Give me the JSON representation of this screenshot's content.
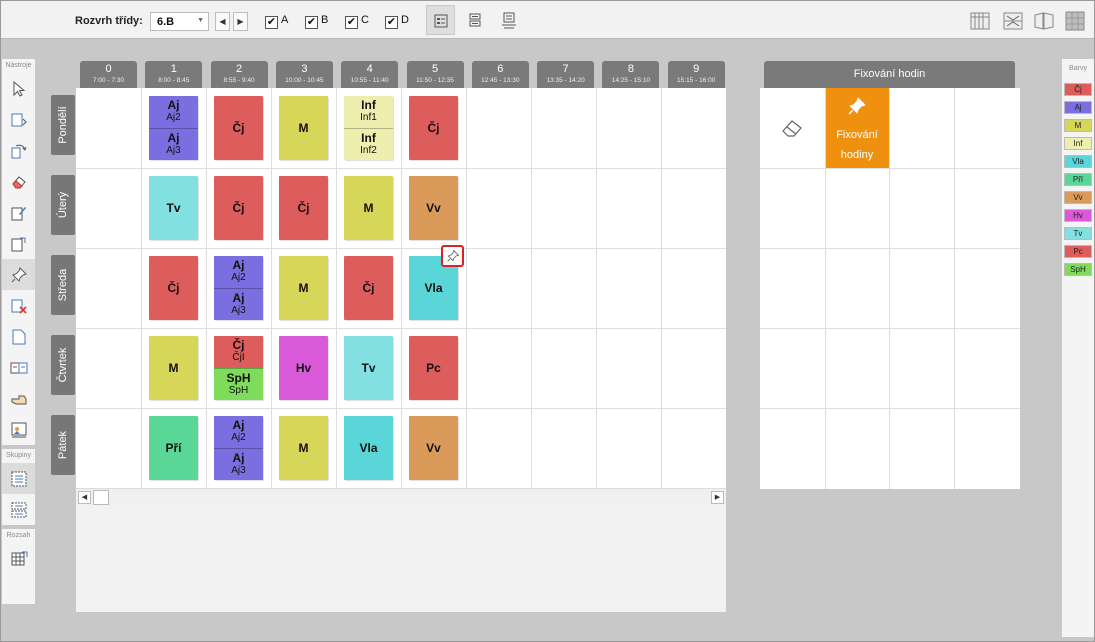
{
  "toolbar": {
    "class_label": "Rozvrh třídy:",
    "class_value": "6.B",
    "prev_arrow": "◀",
    "next_arrow": "▶",
    "groups": [
      {
        "label": "A",
        "checked": true
      },
      {
        "label": "B",
        "checked": true
      },
      {
        "label": "C",
        "checked": true
      },
      {
        "label": "D",
        "checked": true
      }
    ],
    "check_mark": "✔"
  },
  "left_panel": {
    "tools_title": "Nástroje",
    "groups_title": "Skupiny",
    "range_title": "Rozsah"
  },
  "periods": [
    {
      "num": "0",
      "time": "7:00 - 7:30"
    },
    {
      "num": "1",
      "time": "8:00 - 8:45"
    },
    {
      "num": "2",
      "time": "8:55 - 9:40"
    },
    {
      "num": "3",
      "time": "10:00 - 10:45"
    },
    {
      "num": "4",
      "time": "10:55 - 11:40"
    },
    {
      "num": "5",
      "time": "11:50 - 12:35"
    },
    {
      "num": "6",
      "time": "12:45 - 13:30"
    },
    {
      "num": "7",
      "time": "13:35 - 14:20"
    },
    {
      "num": "8",
      "time": "14:25 - 15:10"
    },
    {
      "num": "9",
      "time": "15:15 - 16:00"
    }
  ],
  "days": [
    "Pondělí",
    "Úterý",
    "Středa",
    "Čtvrtek",
    "Pátek"
  ],
  "lessons": [
    {
      "day": 0,
      "period": 1,
      "parts": [
        {
          "s": "Aj",
          "g": "Aj2",
          "color": "#7a6ee0"
        },
        {
          "s": "Aj",
          "g": "Aj3",
          "color": "#7a6ee0"
        }
      ]
    },
    {
      "day": 0,
      "period": 2,
      "parts": [
        {
          "s": "Čj",
          "color": "#dd5c5c"
        }
      ]
    },
    {
      "day": 0,
      "period": 3,
      "parts": [
        {
          "s": "M",
          "color": "#d6d758"
        }
      ]
    },
    {
      "day": 0,
      "period": 4,
      "parts": [
        {
          "s": "Inf",
          "g": "Inf1",
          "color": "#eeeeae"
        },
        {
          "s": "Inf",
          "g": "Inf2",
          "color": "#eeeeae"
        }
      ]
    },
    {
      "day": 0,
      "period": 5,
      "parts": [
        {
          "s": "Čj",
          "color": "#dd5c5c"
        }
      ]
    },
    {
      "day": 1,
      "period": 1,
      "parts": [
        {
          "s": "Tv",
          "color": "#82e0e0"
        }
      ]
    },
    {
      "day": 1,
      "period": 2,
      "parts": [
        {
          "s": "Čj",
          "color": "#dd5c5c"
        }
      ]
    },
    {
      "day": 1,
      "period": 3,
      "parts": [
        {
          "s": "Čj",
          "color": "#dd5c5c"
        }
      ]
    },
    {
      "day": 1,
      "period": 4,
      "parts": [
        {
          "s": "M",
          "color": "#d6d758"
        }
      ]
    },
    {
      "day": 1,
      "period": 5,
      "parts": [
        {
          "s": "Vv",
          "color": "#d99a5a"
        }
      ]
    },
    {
      "day": 2,
      "period": 1,
      "parts": [
        {
          "s": "Čj",
          "color": "#dd5c5c"
        }
      ]
    },
    {
      "day": 2,
      "period": 2,
      "parts": [
        {
          "s": "Aj",
          "g": "Aj2",
          "color": "#7a6ee0"
        },
        {
          "s": "Aj",
          "g": "Aj3",
          "color": "#7a6ee0"
        }
      ]
    },
    {
      "day": 2,
      "period": 3,
      "parts": [
        {
          "s": "M",
          "color": "#d6d758"
        }
      ]
    },
    {
      "day": 2,
      "period": 4,
      "parts": [
        {
          "s": "Čj",
          "color": "#dd5c5c"
        }
      ]
    },
    {
      "day": 2,
      "period": 5,
      "parts": [
        {
          "s": "Vla",
          "color": "#5ad6d8"
        }
      ]
    },
    {
      "day": 3,
      "period": 1,
      "parts": [
        {
          "s": "M",
          "color": "#d6d758"
        }
      ]
    },
    {
      "day": 3,
      "period": 2,
      "parts": [
        {
          "s": "Čj",
          "g": "ČjI",
          "color": "#dd5c5c"
        },
        {
          "s": "SpH",
          "g": "SpH",
          "color": "#7edc5a"
        }
      ]
    },
    {
      "day": 3,
      "period": 3,
      "parts": [
        {
          "s": "Hv",
          "color": "#d85ad8"
        }
      ]
    },
    {
      "day": 3,
      "period": 4,
      "parts": [
        {
          "s": "Tv",
          "color": "#82e0e0"
        }
      ]
    },
    {
      "day": 3,
      "period": 5,
      "parts": [
        {
          "s": "Pc",
          "color": "#dd5c5c"
        }
      ]
    },
    {
      "day": 4,
      "period": 1,
      "parts": [
        {
          "s": "Pří",
          "color": "#5ad696"
        }
      ]
    },
    {
      "day": 4,
      "period": 2,
      "parts": [
        {
          "s": "Aj",
          "g": "Aj2",
          "color": "#7a6ee0"
        },
        {
          "s": "Aj",
          "g": "Aj3",
          "color": "#7a6ee0"
        }
      ]
    },
    {
      "day": 4,
      "period": 3,
      "parts": [
        {
          "s": "M",
          "color": "#d6d758"
        }
      ]
    },
    {
      "day": 4,
      "period": 4,
      "parts": [
        {
          "s": "Vla",
          "color": "#5ad6d8"
        }
      ]
    },
    {
      "day": 4,
      "period": 5,
      "parts": [
        {
          "s": "Vv",
          "color": "#d99a5a"
        }
      ]
    }
  ],
  "scrollbar": {
    "left": "◀",
    "right": "▶"
  },
  "fixing": {
    "title": "Fixování hodin",
    "card_line1": "Fixování",
    "card_line2": "hodiny",
    "card_color": "#f0900f"
  },
  "colors_panel": {
    "title": "Barvy",
    "items": [
      {
        "label": "Čj",
        "color": "#dd5c5c"
      },
      {
        "label": "Aj",
        "color": "#7a6ee0"
      },
      {
        "label": "M",
        "color": "#d6d758"
      },
      {
        "label": "Inf",
        "color": "#eeeeae"
      },
      {
        "label": "Vla",
        "color": "#5ad6d8"
      },
      {
        "label": "Pří",
        "color": "#5ad696"
      },
      {
        "label": "Vv",
        "color": "#d99a5a"
      },
      {
        "label": "Hv",
        "color": "#d85ad8"
      },
      {
        "label": "Tv",
        "color": "#82e0e0"
      },
      {
        "label": "Pc",
        "color": "#dd5c5c"
      },
      {
        "label": "SpH",
        "color": "#7edc5a"
      }
    ]
  }
}
